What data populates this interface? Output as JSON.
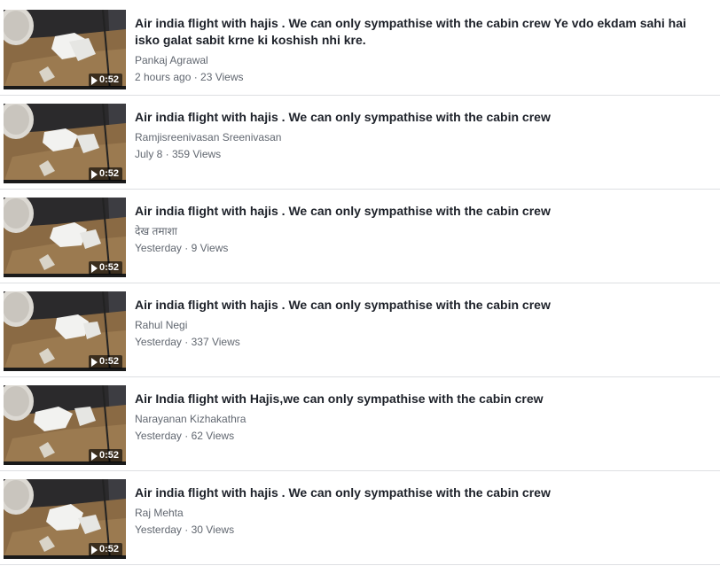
{
  "videos": [
    {
      "title": "Air india flight with hajis . We can only sympathise with the cabin crew Ye vdo ekdam sahi hai isko galat sabit krne ki koshish nhi kre.",
      "author": "Pankaj Agrawal",
      "meta": "2 hours ago · 23 Views",
      "duration": "0:52",
      "play_icon": "play-icon"
    },
    {
      "title": "Air india flight with hajis . We can only sympathise with the cabin crew",
      "author": "Ramjisreenivasan Sreenivasan",
      "meta": "July 8 · 359 Views",
      "duration": "0:52",
      "play_icon": "play-icon"
    },
    {
      "title": "Air india flight with hajis . We can only sympathise with the cabin crew",
      "author": "देख तमाशा",
      "meta": "Yesterday · 9 Views",
      "duration": "0:52",
      "play_icon": "play-icon"
    },
    {
      "title": "Air india flight with hajis . We can only sympathise with the cabin crew",
      "author": "Rahul Negi",
      "meta": "Yesterday · 337 Views",
      "duration": "0:52",
      "play_icon": "play-icon"
    },
    {
      "title": "Air India flight with Hajis,we can only sympathise with the cabin crew",
      "author": "Narayanan Kizhakathra",
      "meta": "Yesterday · 62 Views",
      "duration": "0:52",
      "play_icon": "play-icon"
    },
    {
      "title": "Air india flight with hajis . We can only sympathise with the cabin crew",
      "author": "Raj Mehta",
      "meta": "Yesterday · 30 Views",
      "duration": "0:52",
      "play_icon": "play-icon"
    }
  ],
  "colors": {
    "title": "#1d2129",
    "secondary_text": "#616770",
    "divider": "#dddfe2"
  }
}
